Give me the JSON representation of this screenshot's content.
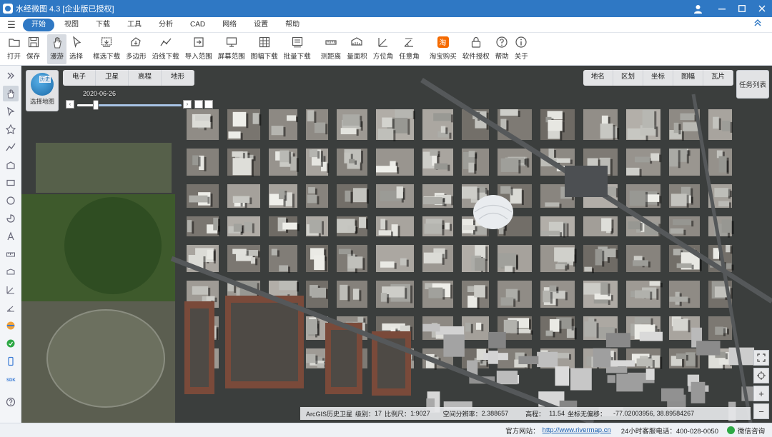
{
  "window": {
    "title": "水经微图 4.3 [企业版已授权]"
  },
  "menu": {
    "items": [
      "开始",
      "视图",
      "下载",
      "工具",
      "分析",
      "CAD",
      "网络",
      "设置",
      "帮助"
    ],
    "active_index": 0
  },
  "toolbar": {
    "items": [
      {
        "label": "打开",
        "icon": "folder-icon"
      },
      {
        "label": "保存",
        "icon": "save-icon"
      },
      {
        "label": "漫游",
        "icon": "hand-icon"
      },
      {
        "label": "选择",
        "icon": "cursor-icon"
      },
      {
        "label": "框选下载",
        "icon": "box-download-icon"
      },
      {
        "label": "多边形",
        "icon": "polygon-icon"
      },
      {
        "label": "沿线下载",
        "icon": "line-download-icon"
      },
      {
        "label": "导入范围",
        "icon": "import-icon"
      },
      {
        "label": "屏幕范围",
        "icon": "screen-icon"
      },
      {
        "label": "图幅下载",
        "icon": "grid-icon"
      },
      {
        "label": "批量下载",
        "icon": "batch-icon"
      },
      {
        "label": "测距离",
        "icon": "ruler-icon"
      },
      {
        "label": "量面积",
        "icon": "area-icon"
      },
      {
        "label": "方位角",
        "icon": "azimuth-icon"
      },
      {
        "label": "任意角",
        "icon": "angle-icon"
      },
      {
        "label": "淘宝购买",
        "icon": "taobao-icon"
      },
      {
        "label": "软件授权",
        "icon": "lock-icon"
      },
      {
        "label": "帮助",
        "icon": "help-icon"
      },
      {
        "label": "关于",
        "icon": "info-icon"
      }
    ],
    "active_label": "漫游"
  },
  "map": {
    "history_button": {
      "badge": "历史",
      "caption": "选择地图"
    },
    "layer_tabs": [
      "电子",
      "卫星",
      "高程",
      "地形"
    ],
    "timeline": {
      "date": "2020-06-26",
      "position": 0.18
    },
    "right_tabs": [
      "地名",
      "区划",
      "坐标",
      "图幅",
      "瓦片"
    ],
    "task_button": "任务列表",
    "status": {
      "source": "ArcGIS历史卫星",
      "level_label": "级别：",
      "level": "17",
      "scale_label": "比例尺：",
      "scale": "1:9027",
      "resolution_label": "空间分辨率：",
      "resolution": "2.388657",
      "elevation_label": "高程：",
      "elevation": "11.54",
      "offset_label": "坐标无偏移：",
      "coords": "-77.02003956, 38.89584267"
    }
  },
  "statusbar": {
    "site_label": "官方网站：",
    "site_url": "http://www.rivermap.cn",
    "hotline": "24小时客服电话：400-028-0050",
    "wechat": "微信咨询"
  }
}
